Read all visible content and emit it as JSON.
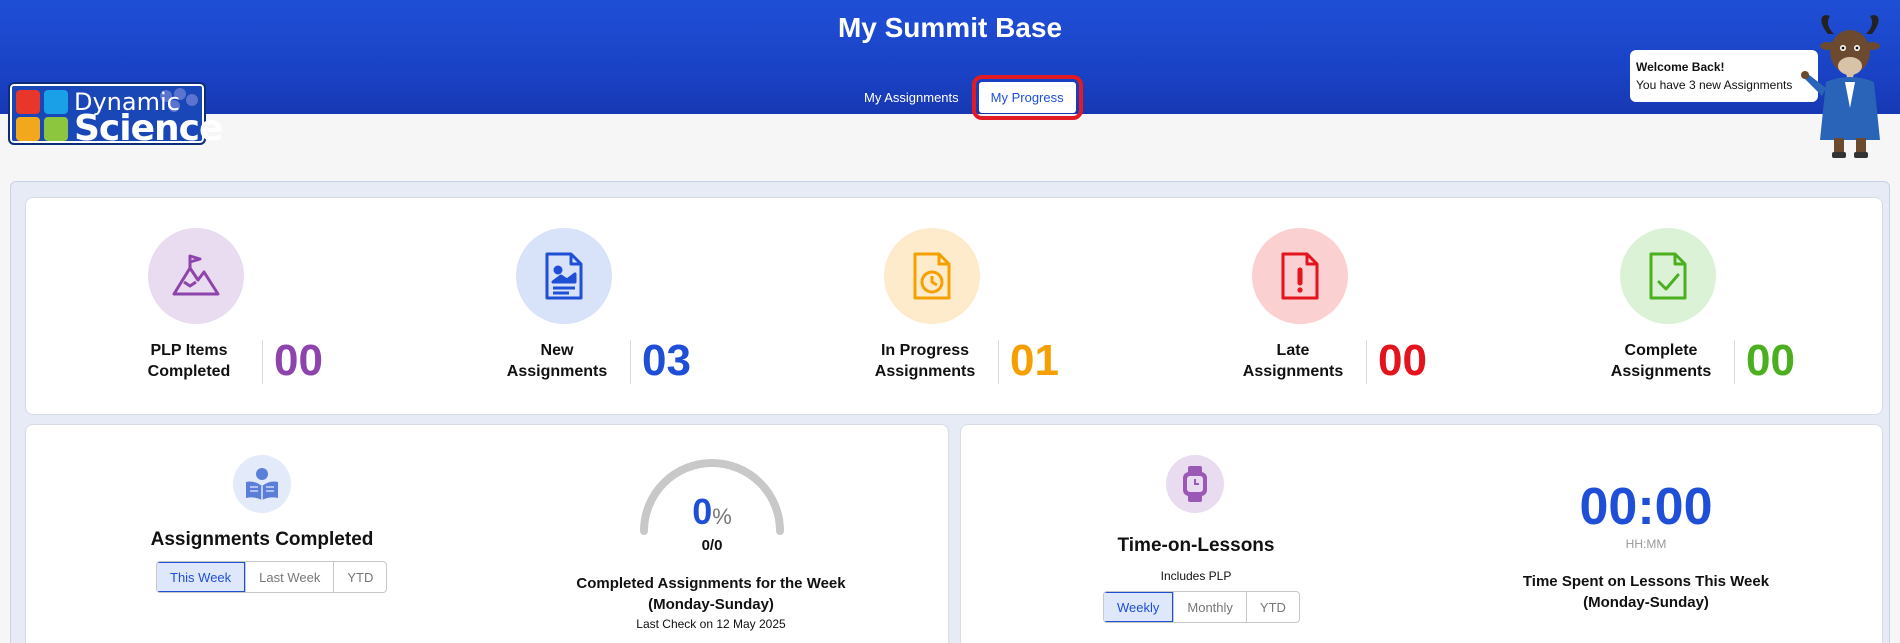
{
  "header": {
    "title": "My Summit Base",
    "tabs": [
      {
        "label": "My Assignments"
      },
      {
        "label": "My Progress"
      }
    ]
  },
  "logo": {
    "line1": "Dynamic",
    "line2": "Science"
  },
  "welcome": {
    "title": "Welcome Back!",
    "message": "You have 3 new Assignments"
  },
  "stats": [
    {
      "label": "PLP Items Completed",
      "value": "00",
      "color": "#8e44ad",
      "bg": "#eadcf0",
      "icon": "mountain-flag-icon"
    },
    {
      "label": "New Assignments",
      "value": "03",
      "color": "#1f4fd6",
      "bg": "#d8e2f8",
      "icon": "document-image-icon"
    },
    {
      "label": "In Progress Assignments",
      "value": "01",
      "color": "#f5a000",
      "bg": "#fdebcc",
      "icon": "document-clock-icon"
    },
    {
      "label": "Late Assignments",
      "value": "00",
      "color": "#e3141e",
      "bg": "#fbd0d0",
      "icon": "document-alert-icon"
    },
    {
      "label": "Complete Assignments",
      "value": "00",
      "color": "#4caf1f",
      "bg": "#dcf2d6",
      "icon": "document-check-icon"
    }
  ],
  "assignments_completed": {
    "title": "Assignments Completed",
    "filters": [
      "This Week",
      "Last Week",
      "YTD"
    ],
    "percent": "0",
    "percent_sign": "%",
    "ratio": "0/0",
    "caption_line1": "Completed Assignments for the Week",
    "caption_line2": "(Monday-Sunday)",
    "last_check": "Last Check on 12 May 2025",
    "progress_fraction": 0
  },
  "time_on_lessons": {
    "title": "Time-on-Lessons",
    "subtitle": "Includes PLP",
    "filters": [
      "Weekly",
      "Monthly",
      "YTD"
    ],
    "time": "00:00",
    "time_format": "HH:MM",
    "caption_line1": "Time Spent on Lessons This Week",
    "caption_line2": "(Monday-Sunday)"
  }
}
